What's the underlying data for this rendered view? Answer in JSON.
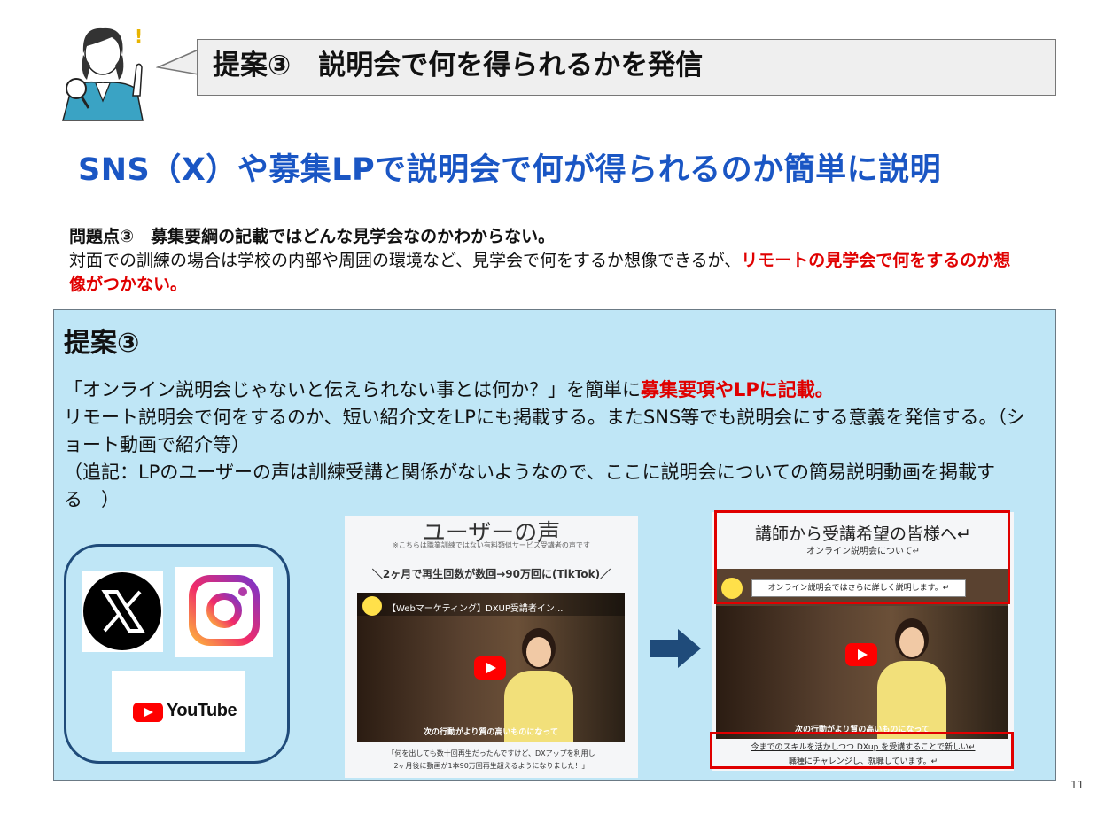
{
  "header": {
    "title": "提案③　説明会で何を得られるかを発信"
  },
  "headline": "SNS（X）や募集LPで説明会で何が得られるのか簡単に説明",
  "problem": {
    "title": "問題点③　募集要綱の記載ではどんな見学会なのかわからない。",
    "body_normal": "対面での訓練の場合は学校の内部や周囲の環境など、見学会で何をするか想像できるが、",
    "body_red": "リモートの見学会で何をするのか想像がつかない。"
  },
  "proposal": {
    "title": "提案③",
    "line1_normal": "「オンライン説明会じゃないと伝えられない事とは何か？」を簡単に",
    "line1_red": "募集要項やLPに記載。",
    "line2": "リモート説明会で何をするのか、短い紹介文をLPにも掲載する。またSNS等でも説明会にする意義を発信する。（ショート動画で紹介等）",
    "line3": "（追記：LPのユーザーの声は訓練受講と関係がないようなので、ここに説明会についての簡易説明動画を掲載する　）"
  },
  "sns": {
    "x_icon": "x-logo-icon",
    "instagram_icon": "instagram-logo-icon",
    "youtube_label": "YouTube"
  },
  "before_shot": {
    "heading": "ユーザーの声",
    "note": "※こちらは職業訓練ではない有料類似サービス受講者の声です",
    "tagline": "＼2ヶ月で再生回数が数回→90万回に(TikTok)／",
    "video_title": "【Webマーケティング】DXUP受講者イン...",
    "video_caption": "次の行動がより質の高いものになって",
    "footer1": "「何を出しても数十回再生だったんですけど、DXアップを利用し",
    "footer2": "2ヶ月後に動画が1本90万回再生超えるようになりました！」"
  },
  "after_shot": {
    "heading": "講師から受講希望の皆様へ↵",
    "sub": "オンライン説明会について↵",
    "banner": "オンライン説明会ではさらに詳しく説明します。↵",
    "video_caption": "次の行動がより質の高いものになって",
    "footer1": "今までのスキルを活かしつつ DXup を受講することで新しい↵",
    "footer2": "職種にチャレンジし、就職しています。↵"
  },
  "colors": {
    "headline": "#1a56c4",
    "highlight": "#e00000",
    "panel_bg": "#bfe6f6",
    "arrow": "#1f4b7a"
  },
  "page_number": "11"
}
